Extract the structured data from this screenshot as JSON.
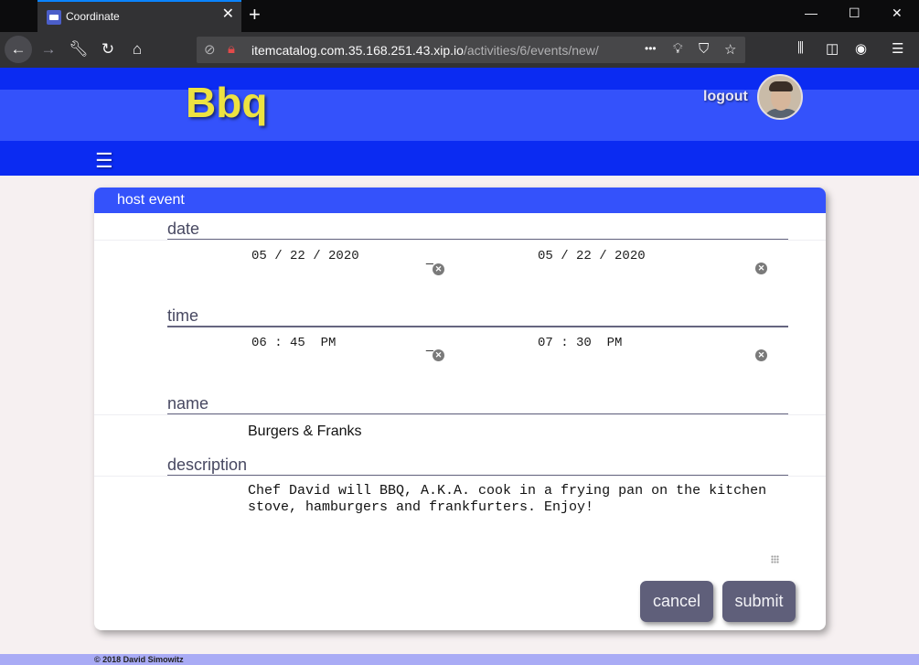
{
  "browser": {
    "tab_title": "Coordinate",
    "tab_close": "✕",
    "new_tab": "+",
    "win_min": "—",
    "win_max": "☐",
    "win_close": "✕",
    "url_host": "itemcatalog.com.35.168.251.43.xip.io",
    "url_path": "/activities/6/events/new/",
    "url_dots": "•••"
  },
  "header": {
    "brand": "Bbq",
    "logout": "logout",
    "menu_icon": "☰"
  },
  "card": {
    "title": "host event",
    "date_label": "date",
    "date_start": "05 / 22 / 2020",
    "date_end": "05 / 22 / 2020",
    "time_label": "time",
    "time_start": "06 : 45  PM",
    "time_end": "07 : 30  PM",
    "range_separator": "_",
    "name_label": "name",
    "name_value": "Burgers & Franks",
    "description_label": "description",
    "description_value": "Chef David will BBQ, A.K.A. cook in a frying pan on the kitchen stove, hamburgers and frankfurters. Enjoy!",
    "cancel_label": "cancel",
    "submit_label": "submit"
  },
  "footer": {
    "copyright": "© 2018 David Simowitz"
  },
  "colors": {
    "header_blue": "#3452fb",
    "header_dark_blue": "#0b2bf2",
    "brand_yellow": "#ede241",
    "button_gray": "#5f5f7a",
    "footer_lilac": "#a9abf5"
  }
}
